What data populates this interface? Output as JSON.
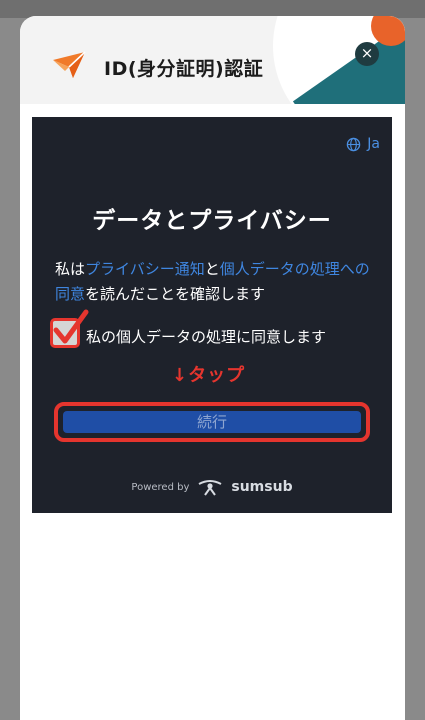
{
  "sheet": {
    "title": "ID(身分証明)認証",
    "close_label": "×"
  },
  "panel": {
    "language": "Ja",
    "title": "データとプライバシー",
    "consent_prefix": "私は",
    "privacy_link": "プライバシー通知",
    "consent_and": "と",
    "processing_link": "個人データの処理への同意",
    "consent_suffix": "を読んだことを確認します",
    "checkbox_label": "私の個人データの処理に同意します",
    "checkbox_checked": true,
    "annotation": "↓タップ",
    "continue_label": "続行",
    "powered_by": "Powered by",
    "provider": "sumsub"
  },
  "colors": {
    "panel_bg": "#1e222b",
    "link": "#3f86e0",
    "highlight": "#e5352e",
    "button": "#1f4ea6",
    "brand_orange": "#f07a2a"
  },
  "icons": [
    "logo-icon",
    "close-icon",
    "globe-icon",
    "checkmark-icon",
    "sumsub-logo-icon"
  ]
}
